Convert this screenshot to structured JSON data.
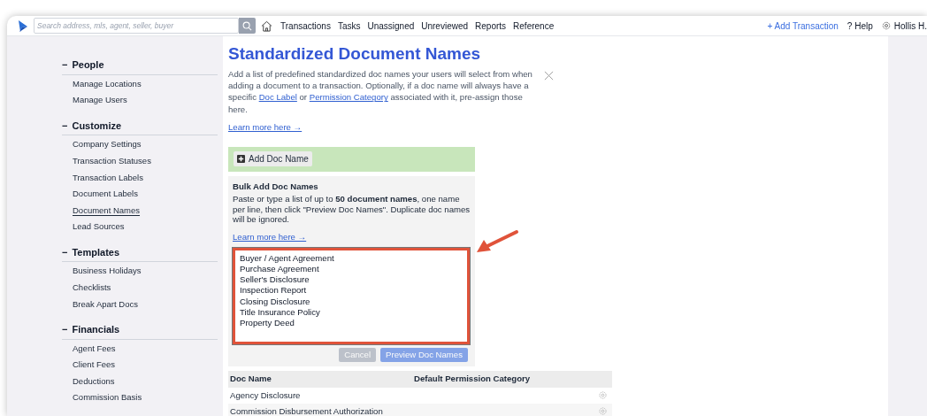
{
  "header": {
    "search": {
      "placeholder": "Search address, mls, agent, seller, buyer"
    },
    "nav": [
      "Transactions",
      "Tasks",
      "Unassigned",
      "Unreviewed",
      "Reports",
      "Reference"
    ],
    "add_transaction": "+ Add Transaction",
    "help": "? Help",
    "user": "Hollis H."
  },
  "sidebar": {
    "sections": [
      {
        "toggle": "−",
        "title": "People",
        "items": [
          {
            "label": "Manage Locations",
            "selected": false
          },
          {
            "label": "Manage Users",
            "selected": false
          }
        ]
      },
      {
        "toggle": "−",
        "title": "Customize",
        "items": [
          {
            "label": "Company Settings",
            "selected": false
          },
          {
            "label": "Transaction Statuses",
            "selected": false
          },
          {
            "label": "Transaction Labels",
            "selected": false
          },
          {
            "label": "Document Labels",
            "selected": false
          },
          {
            "label": "Document Names",
            "selected": true
          },
          {
            "label": "Lead Sources",
            "selected": false
          }
        ]
      },
      {
        "toggle": "−",
        "title": "Templates",
        "items": [
          {
            "label": "Business Holidays",
            "selected": false
          },
          {
            "label": "Checklists",
            "selected": false
          },
          {
            "label": "Break Apart Docs",
            "selected": false
          }
        ]
      },
      {
        "toggle": "−",
        "title": "Financials",
        "items": [
          {
            "label": "Agent Fees",
            "selected": false
          },
          {
            "label": "Client Fees",
            "selected": false
          },
          {
            "label": "Deductions",
            "selected": false
          },
          {
            "label": "Commission Basis",
            "selected": false
          }
        ]
      }
    ]
  },
  "main": {
    "title": "Standardized Document Names",
    "intro": {
      "before": "Add a list of predefined standardized doc names your users will select from when adding a document to a transaction. Optionally, if a doc name will always have a specific ",
      "link_1": "Doc Label",
      "between": " or ",
      "link_2": "Permission Category",
      "after": " associated with it, pre-assign those here."
    },
    "learn_more": "Learn more here →",
    "add_button": "Add Doc Name",
    "bulk": {
      "title": "Bulk Add Doc Names",
      "text": "Paste or type a list of up to **50 document names**, one name per line, then click \"Preview Doc Names\". Duplicate doc names will be ignored.",
      "learn_more": "Learn more here →",
      "textarea": {
        "value": "Buyer / Agent Agreement\nPurchase Agreement\nSeller's Disclosure\nInspection Report\nClosing Disclosure\nTitle Insurance Policy\nProperty Deed",
        "highlighted": true
      },
      "buttons": [
        {
          "label": "Cancel",
          "kind": "secondary",
          "disabled": true
        },
        {
          "label": "Preview Doc Names",
          "kind": "primary",
          "disabled": true
        }
      ]
    },
    "table": {
      "columns": [
        "Doc Name",
        "Default Permission Category"
      ],
      "rows": [
        {
          "doc_name": "Agency Disclosure"
        },
        {
          "doc_name": "Commission Disbursement Authorization"
        }
      ]
    }
  }
}
